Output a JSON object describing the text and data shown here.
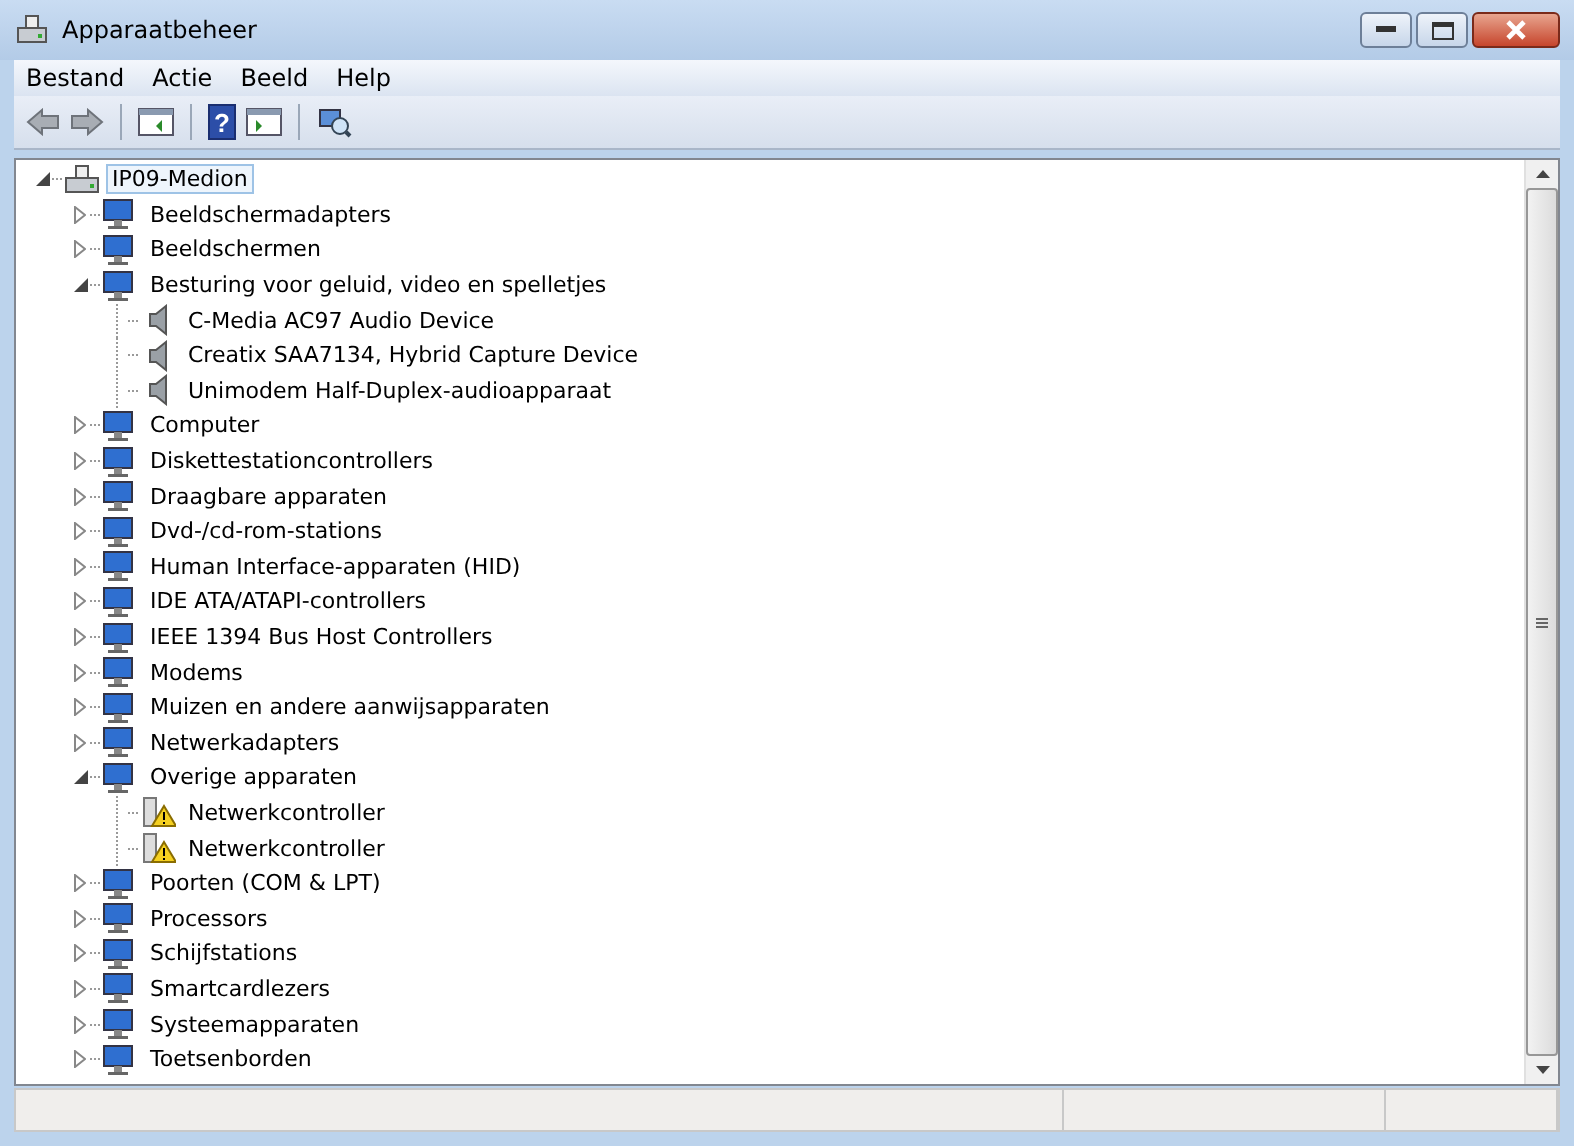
{
  "window": {
    "title": "Apparaatbeheer"
  },
  "menu": [
    "Bestand",
    "Actie",
    "Beeld",
    "Help"
  ],
  "toolbar": {
    "help_glyph": "?"
  },
  "tree": [
    {
      "label": "IP09-Medion",
      "selected": true,
      "expanded": true,
      "children": [
        {
          "label": "Beeldschermadapters",
          "expanded": false
        },
        {
          "label": "Beeldschermen",
          "expanded": false
        },
        {
          "label": "Besturing voor geluid, video en spelletjes",
          "expanded": true,
          "children": [
            {
              "label": "C-Media AC97 Audio Device",
              "warning": false
            },
            {
              "label": "Creatix SAA7134, Hybrid Capture Device",
              "warning": false
            },
            {
              "label": "Unimodem Half-Duplex-audioapparaat",
              "warning": false
            }
          ]
        },
        {
          "label": "Computer",
          "expanded": false
        },
        {
          "label": "Diskettestationcontrollers",
          "expanded": false
        },
        {
          "label": "Draagbare apparaten",
          "expanded": false
        },
        {
          "label": "Dvd-/cd-rom-stations",
          "expanded": false
        },
        {
          "label": "Human Interface-apparaten (HID)",
          "expanded": false
        },
        {
          "label": "IDE ATA/ATAPI-controllers",
          "expanded": false
        },
        {
          "label": "IEEE 1394 Bus Host Controllers",
          "expanded": false
        },
        {
          "label": "Modems",
          "expanded": false
        },
        {
          "label": "Muizen en andere aanwijsapparaten",
          "expanded": false
        },
        {
          "label": "Netwerkadapters",
          "expanded": false
        },
        {
          "label": "Overige apparaten",
          "expanded": true,
          "children": [
            {
              "label": "Netwerkcontroller",
              "warning": true
            },
            {
              "label": "Netwerkcontroller",
              "warning": true
            }
          ]
        },
        {
          "label": "Poorten (COM & LPT)",
          "expanded": false
        },
        {
          "label": "Processors",
          "expanded": false
        },
        {
          "label": "Schijfstations",
          "expanded": false
        },
        {
          "label": "Smartcardlezers",
          "expanded": false
        },
        {
          "label": "Systeemapparaten",
          "expanded": false
        },
        {
          "label": "Toetsenborden",
          "expanded": false
        }
      ]
    }
  ]
}
